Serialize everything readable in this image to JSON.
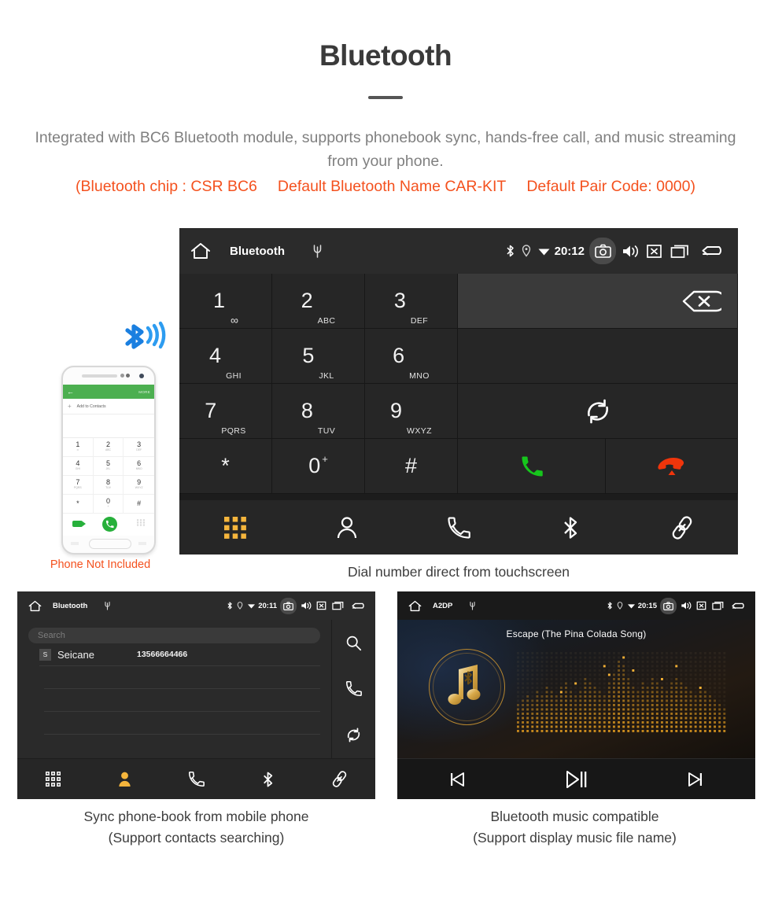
{
  "header": {
    "title": "Bluetooth",
    "description": "Integrated with BC6 Bluetooth module, supports phonebook sync, hands-free call, and music streaming from your phone.",
    "spec_open": "(Bluetooth chip : CSR BC6",
    "spec_name": "Default Bluetooth Name CAR-KIT",
    "spec_code": "Default Pair Code: 0000)",
    "accent_color": "#f4511e",
    "text_color": "#808080"
  },
  "phone_mockup": {
    "caption": "Phone Not Included",
    "app_bar_back": "←",
    "app_bar_more": "MORE",
    "add_to_contacts": "Add to Contacts",
    "add_plus": "+",
    "keys": [
      {
        "num": "1",
        "sub": "∞"
      },
      {
        "num": "2",
        "sub": "ABC"
      },
      {
        "num": "3",
        "sub": "DEF"
      },
      {
        "num": "4",
        "sub": "GHI"
      },
      {
        "num": "5",
        "sub": "JKL"
      },
      {
        "num": "6",
        "sub": "MNO"
      },
      {
        "num": "7",
        "sub": "PQRS"
      },
      {
        "num": "8",
        "sub": "TUV"
      },
      {
        "num": "9",
        "sub": "WXYZ"
      },
      {
        "num": "*",
        "sub": ""
      },
      {
        "num": "0",
        "sub": "+"
      },
      {
        "num": "#",
        "sub": ""
      }
    ],
    "bluetooth_icon": "bluetooth-signal-icon"
  },
  "dialer": {
    "status": {
      "home_icon": "home-icon",
      "title": "Bluetooth",
      "usb_icon": "usb-icon",
      "bluetooth_icon": "bluetooth-icon",
      "location_icon": "location-icon",
      "wifi_icon": "wifi-icon",
      "time": "20:12",
      "camera_icon": "camera-icon",
      "volume_icon": "volume-icon",
      "close_icon": "close-box-icon",
      "recents_icon": "recent-apps-icon",
      "back_icon": "back-arrow-icon"
    },
    "input_value": "",
    "backspace_icon": "backspace-icon",
    "keys": [
      {
        "num": "1",
        "sub": "",
        "vm": "∞"
      },
      {
        "num": "2",
        "sub": "ABC",
        "vm": ""
      },
      {
        "num": "3",
        "sub": "DEF",
        "vm": ""
      },
      {
        "num": "4",
        "sub": "GHI",
        "vm": ""
      },
      {
        "num": "5",
        "sub": "JKL",
        "vm": ""
      },
      {
        "num": "6",
        "sub": "MNO",
        "vm": ""
      },
      {
        "num": "7",
        "sub": "PQRS",
        "vm": ""
      },
      {
        "num": "8",
        "sub": "TUV",
        "vm": ""
      },
      {
        "num": "9",
        "sub": "WXYZ",
        "vm": ""
      },
      {
        "num": "*",
        "sub": "",
        "vm": ""
      },
      {
        "num": "0",
        "sub": "",
        "vm": ""
      },
      {
        "num": "#",
        "sub": "",
        "vm": ""
      }
    ],
    "zero_plus": "+",
    "sync_icon": "sync-icon",
    "call_icon": "call-icon",
    "hangup_icon": "hangup-icon",
    "call_color": "#16c61c",
    "hangup_color": "#f0350b",
    "nav": [
      {
        "name": "keypad-tab",
        "icon": "keypad-icon",
        "active": true
      },
      {
        "name": "contacts-tab",
        "icon": "person-icon",
        "active": false
      },
      {
        "name": "call-log-tab",
        "icon": "handset-icon",
        "active": false
      },
      {
        "name": "bluetooth-tab",
        "icon": "bluetooth-icon",
        "active": false
      },
      {
        "name": "pair-link-tab",
        "icon": "link-icon",
        "active": false
      }
    ],
    "active_color": "#f5b53c",
    "caption": "Dial number direct from touchscreen"
  },
  "phonebook": {
    "status": {
      "title": "Bluetooth",
      "time": "20:11"
    },
    "search_placeholder": "Search",
    "contacts": [
      {
        "initial": "S",
        "name": "Seicane",
        "number": "13566664466"
      }
    ],
    "empty_rows": 3,
    "rail": [
      {
        "name": "search-button",
        "icon": "search-icon"
      },
      {
        "name": "call-button",
        "icon": "handset-icon"
      },
      {
        "name": "sync-button",
        "icon": "sync-icon"
      }
    ],
    "nav": [
      {
        "name": "keypad-tab",
        "icon": "keypad-icon",
        "active": false
      },
      {
        "name": "contacts-tab",
        "icon": "person-icon",
        "active": true
      },
      {
        "name": "call-log-tab",
        "icon": "handset-icon",
        "active": false
      },
      {
        "name": "bluetooth-tab",
        "icon": "bluetooth-icon",
        "active": false
      },
      {
        "name": "pair-link-tab",
        "icon": "link-icon",
        "active": false
      }
    ],
    "caption_line1": "Sync phone-book from mobile phone",
    "caption_line2": "(Support contacts searching)"
  },
  "music": {
    "status": {
      "title": "A2DP",
      "time": "20:15"
    },
    "track_title": "Escape (The Pina Colada Song)",
    "album_art_icon": "music-note-bluetooth-icon",
    "visualizer": "dot-matrix-spectrum",
    "controls": [
      {
        "name": "previous-track-button",
        "icon": "previous-icon"
      },
      {
        "name": "play-pause-button",
        "icon": "play-pause-icon"
      },
      {
        "name": "next-track-button",
        "icon": "next-icon"
      }
    ],
    "caption_line1": "Bluetooth music compatible",
    "caption_line2": "(Support display music file name)"
  }
}
